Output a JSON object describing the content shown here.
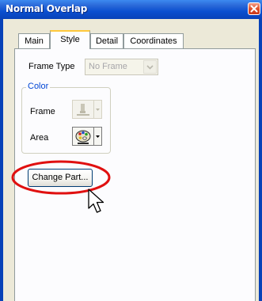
{
  "window": {
    "title": "Normal Overlap"
  },
  "tabs": [
    {
      "label": "Main"
    },
    {
      "label": "Style"
    },
    {
      "label": "Detail"
    },
    {
      "label": "Coordinates"
    }
  ],
  "active_tab": "Style",
  "frame_type": {
    "label": "Frame Type",
    "value": "No Frame"
  },
  "color_group": {
    "legend": "Color",
    "frame_label": "Frame",
    "area_label": "Area"
  },
  "change_part_button": {
    "label": "Change Part..."
  },
  "colors": {
    "titlebar": "#0A4FD0",
    "highlight_ellipse": "#E01010",
    "group_legend_text": "#0046D5"
  }
}
